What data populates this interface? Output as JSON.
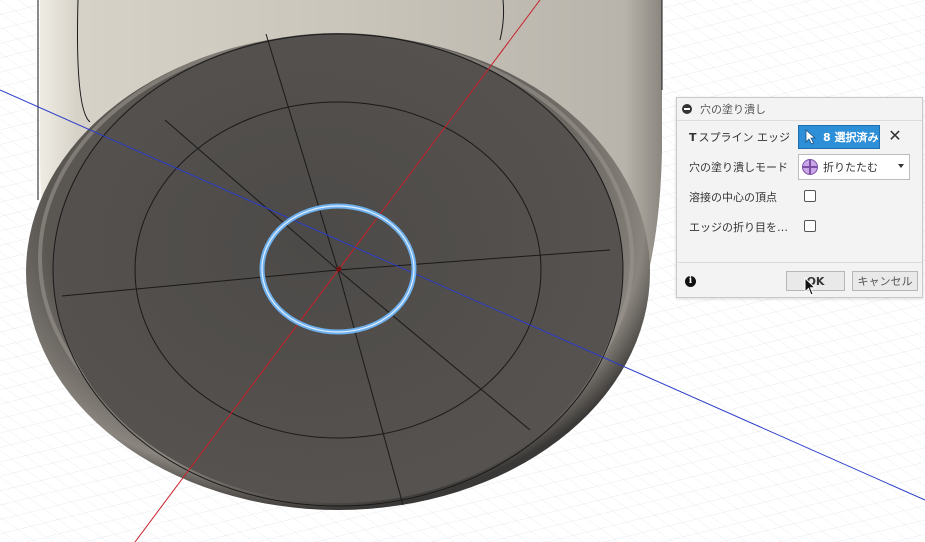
{
  "dialog": {
    "title": "穴の塗り潰し",
    "tspline_edge": {
      "prefix": "T",
      "label": "スプライン エッジ",
      "selection_text": "8 選択済み",
      "clear_label": "✕"
    },
    "fill_mode": {
      "label": "穴の塗り潰しモード",
      "value": "折りたたむ"
    },
    "weld_center": {
      "label": "溶接の中心の頂点",
      "checked": false
    },
    "keep_crease": {
      "label": "エッジの折り目を維持",
      "checked": false
    },
    "info_label": "i",
    "ok_label": "OK",
    "cancel_label": "キャンセル"
  },
  "colors": {
    "selection_blue": "#2d8fd8",
    "x_axis": "#c8202a",
    "y_axis": "#2a3cc8",
    "surface": "#4f4c49",
    "highlight_edge": "#6fb1ee"
  },
  "icons": {
    "collapse": "collapse-icon",
    "select_cursor": "cursor-arrow-icon",
    "fill_mode": "fold-mode-icon",
    "info": "info-icon",
    "mouse": "mouse-pointer-icon"
  }
}
